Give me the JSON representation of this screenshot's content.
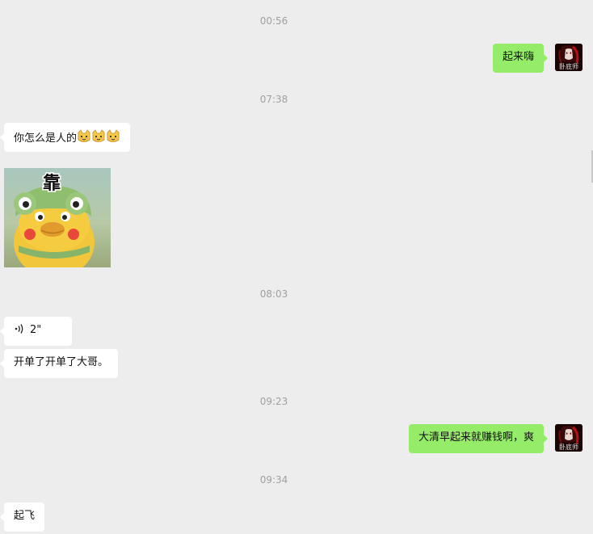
{
  "timestamps": [
    "00:56",
    "07:38",
    "08:03",
    "09:23",
    "09:34"
  ],
  "messages": {
    "m1_text": "起来嗨",
    "m2_text": "你怎么是人的",
    "m2_emojis": [
      "cat-emoji",
      "cat-emoji",
      "cat-emoji"
    ],
    "sticker_label": "靠",
    "voice_duration": "2\"",
    "m4_text": "开单了开单了大哥。",
    "m5_text": "大清早起来就赚钱啊，爽",
    "m6_text": "起飞"
  },
  "avatar_caption": "卧底师",
  "colors": {
    "background": "#ededed",
    "outgoing_bubble": "#95ec69",
    "incoming_bubble": "#ffffff",
    "timestamp": "#a0a0a0"
  }
}
